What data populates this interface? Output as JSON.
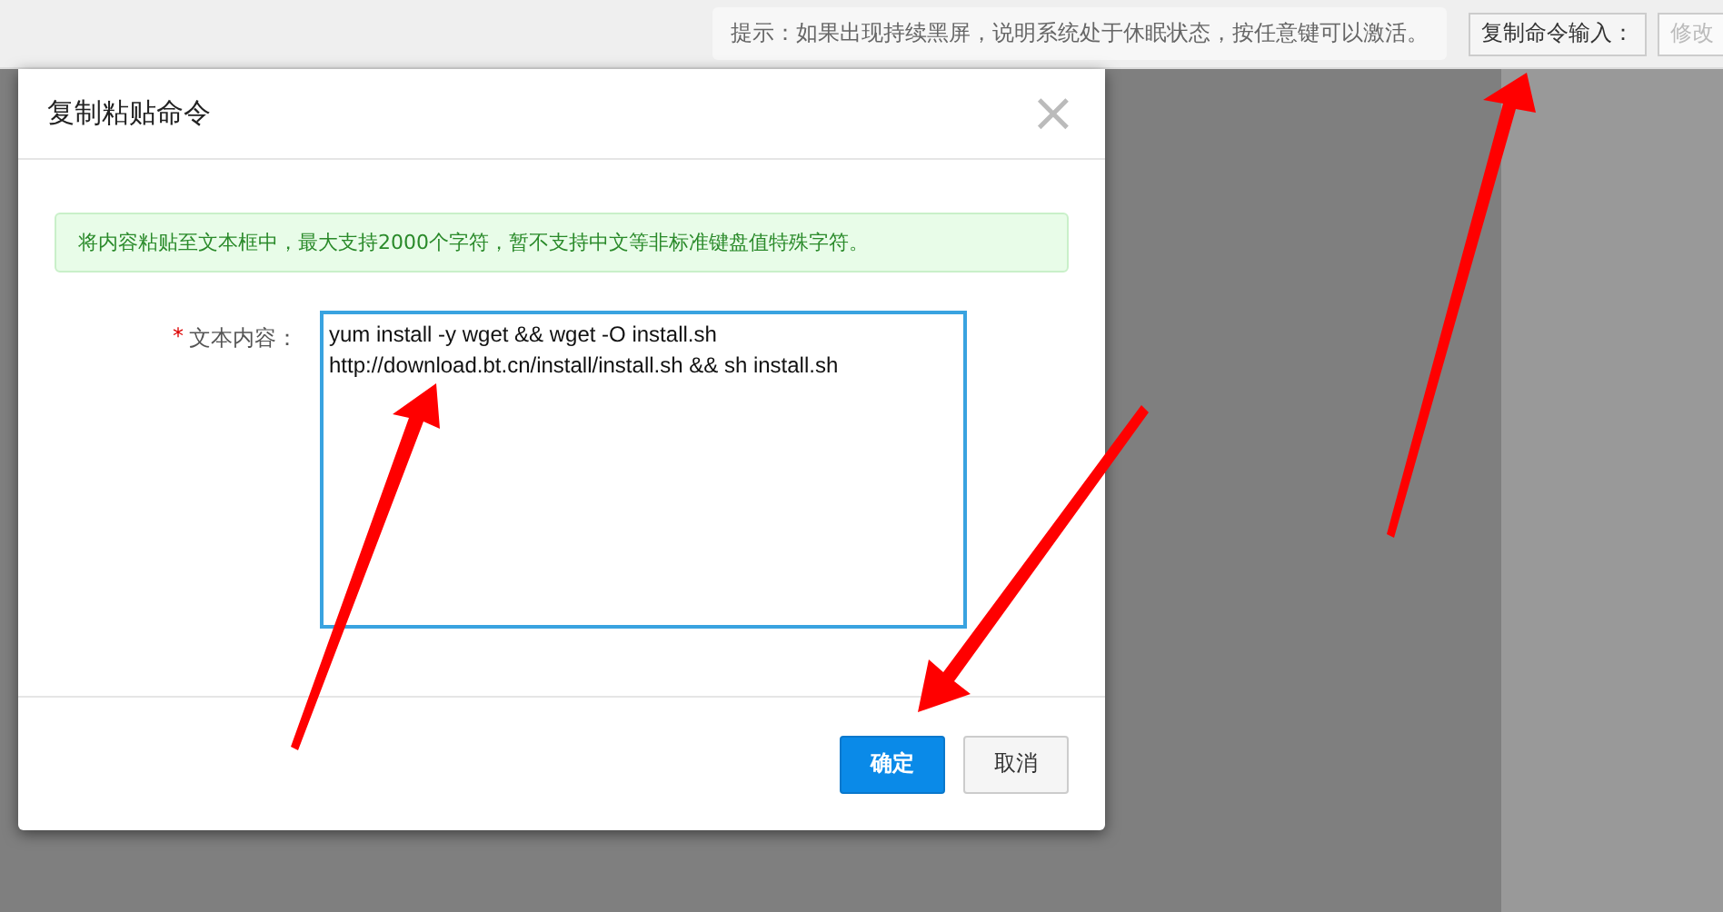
{
  "top_bar": {
    "hint": "提示：如果出现持续黑屏，说明系统处于休眠状态，按任意键可以激活。",
    "buttons": [
      {
        "label": "复制命令输入：",
        "disabled": false
      },
      {
        "label": "修改",
        "disabled": true
      }
    ]
  },
  "dialog": {
    "title": "复制粘贴命令",
    "close": "×",
    "notice": "将内容粘贴至文本框中，最大支持2000个字符，暂不支持中文等非标准键盘值特殊字符。",
    "field": {
      "label": "文本内容：",
      "required": true,
      "required_mark": "*",
      "value": "yum install -y wget && wget -O install.sh\nhttp://download.bt.cn/install/install.sh && sh install.sh"
    },
    "buttons": [
      {
        "label": "确定",
        "kind": "primary"
      },
      {
        "label": "取消",
        "kind": "secondary"
      }
    ]
  }
}
